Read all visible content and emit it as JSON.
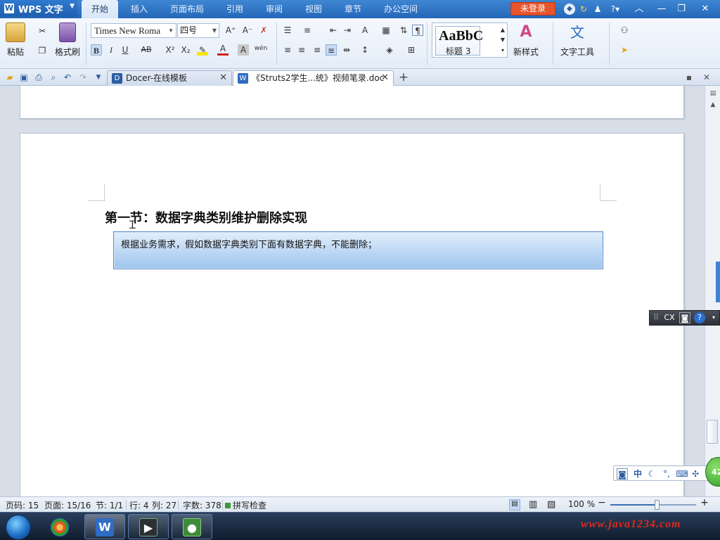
{
  "app": {
    "name": "WPS 文字",
    "menu_tabs": [
      "开始",
      "插入",
      "页面布局",
      "引用",
      "审阅",
      "视图",
      "章节",
      "办公空间"
    ],
    "active_tab": "开始",
    "login_label": "未登录"
  },
  "ribbon": {
    "paste_label": "粘贴",
    "format_painter_label": "格式刷",
    "font_name": "Times New Roma",
    "font_size": "四号",
    "style_sample": "AaBbC",
    "style_name": "标题 3",
    "new_style_label": "新样式",
    "text_tools_label": "文字工具",
    "bold_glyph": "B",
    "italic_glyph": "I",
    "underline_glyph": "U",
    "strike_glyph": "AB",
    "superscript_glyph": "X²",
    "subscript_glyph": "X₂",
    "font_grow_glyph": "A⁺",
    "font_shrink_glyph": "A⁻",
    "phonetic_glyph": "wén"
  },
  "tabs": {
    "docer_tab": "Docer-在线模板",
    "doc_tab": "《Struts2学生...统》视频笔录.doc"
  },
  "document": {
    "heading": "第一节：数据字典类别维护删除实现",
    "callout": "根据业务需求，假如数据字典类别下面有数据字典，不能删除；"
  },
  "ime": {
    "mode_label": "CX",
    "chinese_label": "中",
    "ball_label": "42"
  },
  "status": {
    "page_code": "页码: 15",
    "page": "页面: 15/16",
    "section": "节: 1/1",
    "line": "行: 4",
    "column": "列: 27",
    "word_count": "字数: 378",
    "spell_check": "拼写检查",
    "zoom": "100 %",
    "zoom_fraction": 0.55
  },
  "taskbar": {
    "watermark": "www.java1234.com"
  },
  "colors": {
    "title_bar": "#2f74c4",
    "login_button": "#e8542b",
    "callout_top": "#e2eefb",
    "callout_bottom": "#9ec4ee",
    "callout_border": "#5a8ac6",
    "watermark": "#e0261b"
  }
}
